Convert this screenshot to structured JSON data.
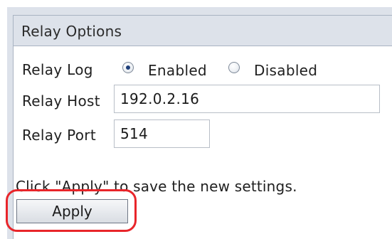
{
  "panel": {
    "title": "Relay Options"
  },
  "relay_log": {
    "label": "Relay Log",
    "options": [
      {
        "label": "Enabled",
        "selected": true
      },
      {
        "label": "Disabled",
        "selected": false
      }
    ]
  },
  "relay_host": {
    "label": "Relay Host",
    "value": "192.0.2.16"
  },
  "relay_port": {
    "label": "Relay Port",
    "value": "514"
  },
  "footer": {
    "hint": "Click \"Apply\" to save the new settings.",
    "apply_label": "Apply"
  },
  "colors": {
    "highlight": "#e8252a",
    "header_bg": "#dde2ea"
  }
}
